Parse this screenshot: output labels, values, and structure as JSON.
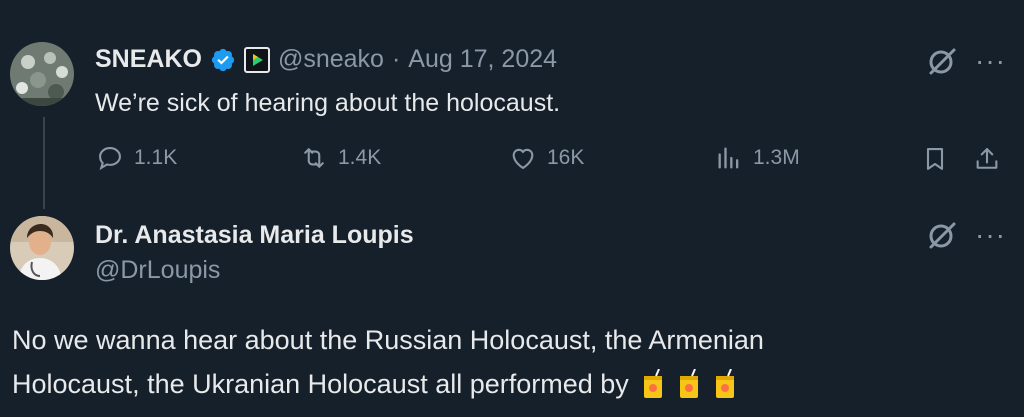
{
  "tweet1": {
    "name": "SNEAKO",
    "handle": "@sneako",
    "separator": "·",
    "date": "Aug 17, 2024",
    "text": "We’re sick of hearing about the holocaust.",
    "stats": {
      "replies": "1.1K",
      "reposts": "1.4K",
      "likes": "16K",
      "views": "1.3M"
    }
  },
  "tweet2": {
    "name": "Dr. Anastasia Maria Loupis",
    "handle": "@DrLoupis",
    "text_line1": "No we wanna hear about the Russian Holocaust, the Armenian",
    "text_line2": "Holocaust, the Ukranian Holocaust all performed by"
  },
  "colors": {
    "background": "#15202b",
    "text": "#e7e9ea",
    "muted": "#8b98a5",
    "verified": "#1d9bf0",
    "juice": "#f5c518"
  },
  "icons": [
    "grok-icon",
    "more-icon",
    "reply-icon",
    "repost-icon",
    "like-icon",
    "views-icon",
    "bookmark-icon",
    "share-icon",
    "verified-badge-icon",
    "affiliate-badge-icon",
    "juice-box-icon"
  ]
}
